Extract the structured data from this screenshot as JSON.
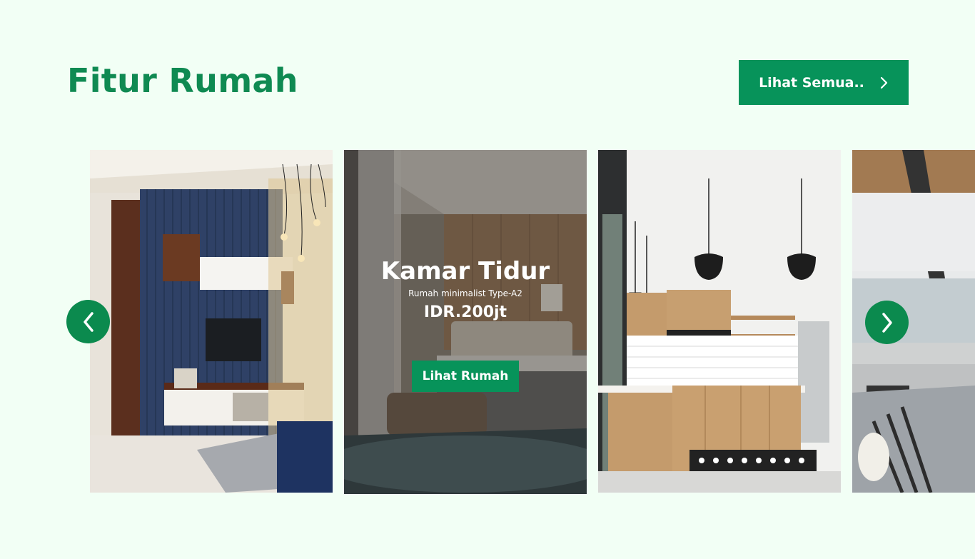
{
  "header": {
    "title": "Fitur Rumah",
    "see_all_label": "Lihat Semua.."
  },
  "carousel": {
    "active_card": {
      "title": "Kamar Tidur",
      "subtitle": "Rumah minimalist Type-A2",
      "price": "IDR.200jt",
      "button_label": "Lihat Rumah"
    },
    "cards": [
      {
        "scene": "living-room"
      },
      {
        "scene": "bedroom"
      },
      {
        "scene": "kitchen"
      },
      {
        "scene": "open-living-area"
      }
    ],
    "prev_icon": "chevron-left-icon",
    "next_icon": "chevron-right-icon"
  },
  "colors": {
    "background": "#f2fff5",
    "brand_green": "#07935a",
    "title_green": "#0f8a52",
    "arrow_green": "#0b8a4e"
  }
}
